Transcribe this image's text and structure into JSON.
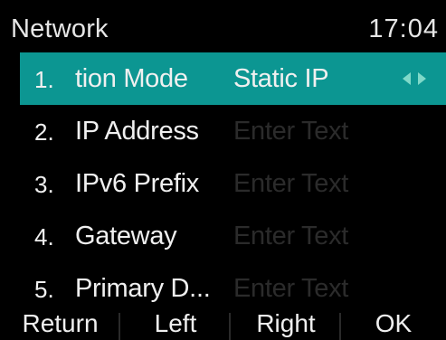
{
  "status": {
    "title": "Network",
    "time": "17:04"
  },
  "list": {
    "items": [
      {
        "num": "1.",
        "label": "tion Mode",
        "value": "Static IP"
      },
      {
        "num": "2.",
        "label": "IP Address",
        "value": "Enter Text"
      },
      {
        "num": "3.",
        "label": "IPv6 Prefix",
        "value": "Enter Text"
      },
      {
        "num": "4.",
        "label": "Gateway",
        "value": "Enter Text"
      },
      {
        "num": "5.",
        "label": "Primary D...",
        "value": "Enter Text"
      }
    ]
  },
  "softkeys": {
    "return": "Return",
    "left": "Left",
    "right": "Right",
    "ok": "OK"
  },
  "colors": {
    "accent": "#0c9692",
    "background": "#000000",
    "text": "#f0f0f0",
    "arrow": "#7fd9c9"
  },
  "icons": {
    "selector_arrows": "left-right-arrows-icon"
  }
}
